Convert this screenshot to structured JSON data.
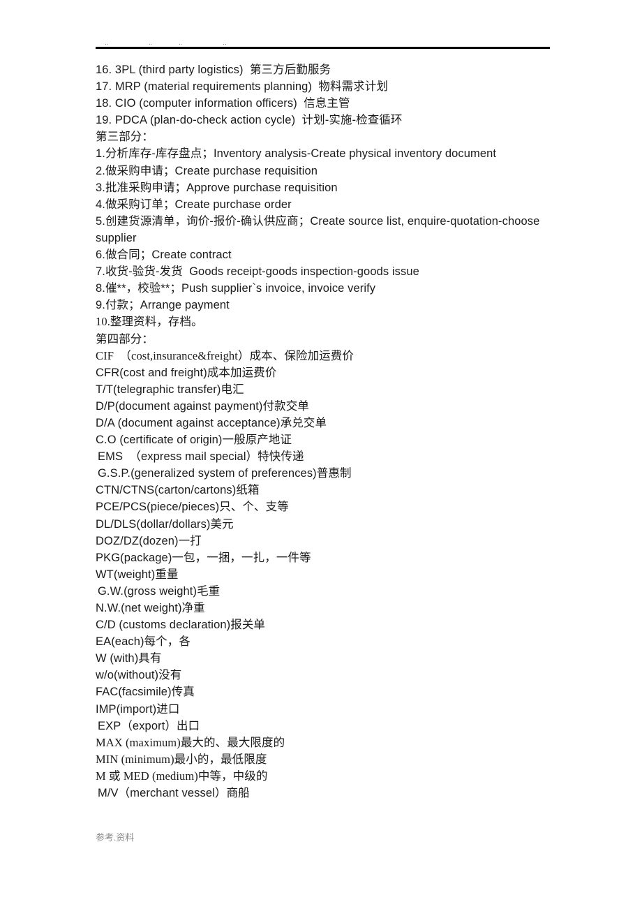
{
  "header": {
    "marks": [
      {
        "text": "..",
        "left_pct": 13.5
      },
      {
        "text": "..",
        "left_pct": 76.2
      },
      {
        "text": "..",
        "left_pct": 119.5
      },
      {
        "text": "..",
        "left_pct": 182.8
      }
    ]
  },
  "body": {
    "lines": [
      {
        "text": "16. 3PL (third party logistics)  第三方后勤服务",
        "style": "sans"
      },
      {
        "text": "17. MRP (material requirements planning)  物料需求计划",
        "style": "sans"
      },
      {
        "text": "18. CIO (computer information officers)  信息主管",
        "style": "sans"
      },
      {
        "text": "19. PDCA (plan-do-check action cycle)  计划-实施-检查循环",
        "style": "sans"
      },
      {
        "text": "第三部分：",
        "style": "sans"
      },
      {
        "text": "1.分析库存-库存盘点；Inventory analysis-Create physical inventory document",
        "style": "sans"
      },
      {
        "text": "2.做采购申请；Create purchase requisition",
        "style": "sans"
      },
      {
        "text": "3.批准采购申请；Approve purchase requisition",
        "style": "sans"
      },
      {
        "text": "4.做采购订单；Create purchase order",
        "style": "sans"
      },
      {
        "text": "5.创建货源清单，询价-报价-确认供应商；Create source list, enquire-quotation-choose supplier",
        "style": "sans",
        "wrap": true
      },
      {
        "text": "6.做合同；Create contract",
        "style": "sans"
      },
      {
        "text": "7.收货-验货-发货  Goods receipt-goods inspection-goods issue",
        "style": "sans"
      },
      {
        "text": "8.催**，校验**；Push supplier`s invoice, invoice verify",
        "style": "sans"
      },
      {
        "text": "9.付款；Arrange payment",
        "style": "sans"
      },
      {
        "text": "10.整理资料，存档。",
        "style": "serif"
      },
      {
        "text": "第四部分：",
        "style": "sans"
      },
      {
        "text": "CIF  （cost,insurance&freight）成本、保险加运费价",
        "style": "serif"
      },
      {
        "text": "CFR(cost and freight)成本加运费价",
        "style": "sans"
      },
      {
        "text": "T/T(telegraphic transfer)电汇",
        "style": "sans"
      },
      {
        "text": "D/P(document against payment)付款交单",
        "style": "sans"
      },
      {
        "text": "D/A (document against acceptance)承兑交单",
        "style": "sans"
      },
      {
        "text": "C.O (certificate of origin)一般原产地证",
        "style": "sans"
      },
      {
        "text": "EMS  （express mail special）特快传递",
        "style": "sans",
        "indent": true
      },
      {
        "text": "G.S.P.(generalized system of preferences)普惠制",
        "style": "sans",
        "indent": true
      },
      {
        "text": "CTN/CTNS(carton/cartons)纸箱",
        "style": "sans"
      },
      {
        "text": "PCE/PCS(piece/pieces)只、个、支等",
        "style": "sans"
      },
      {
        "text": "DL/DLS(dollar/dollars)美元",
        "style": "sans"
      },
      {
        "text": "DOZ/DZ(dozen)一打",
        "style": "sans"
      },
      {
        "text": "PKG(package)一包，一捆，一扎，一件等",
        "style": "sans"
      },
      {
        "text": "WT(weight)重量",
        "style": "sans"
      },
      {
        "text": "G.W.(gross weight)毛重",
        "style": "sans",
        "indent": true
      },
      {
        "text": "N.W.(net weight)净重",
        "style": "sans"
      },
      {
        "text": "C/D (customs declaration)报关单",
        "style": "sans"
      },
      {
        "text": "EA(each)每个，各",
        "style": "sans"
      },
      {
        "text": "W (with)具有",
        "style": "sans"
      },
      {
        "text": "w/o(without)没有",
        "style": "sans"
      },
      {
        "text": "FAC(facsimile)传真",
        "style": "sans"
      },
      {
        "text": "IMP(import)进口",
        "style": "sans"
      },
      {
        "text": "EXP（export）出口",
        "style": "sans",
        "indent": true
      },
      {
        "text": "MAX (maximum)最大的、最大限度的",
        "style": "serif"
      },
      {
        "text": "MIN (minimum)最小的，最低限度",
        "style": "serif"
      },
      {
        "text": "M 或 MED (medium)中等，中级的",
        "style": "serif"
      },
      {
        "text": "M/V（merchant vessel）商船",
        "style": "sans",
        "indent": true
      }
    ]
  },
  "footer": {
    "text": "参考.资料"
  }
}
